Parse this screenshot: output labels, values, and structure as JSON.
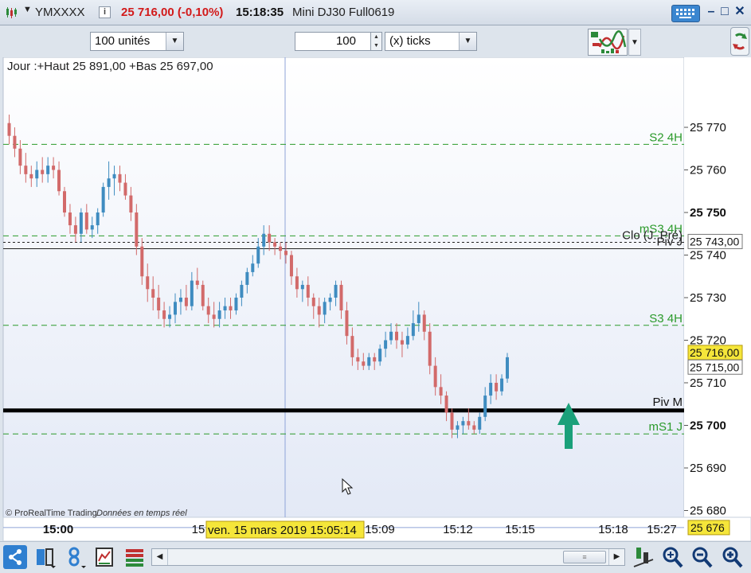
{
  "titlebar": {
    "symbol": "YMXXXX",
    "price": "25 716,00 (-0,10%)",
    "clock": "15:18:35",
    "instrument": "Mini DJ30 Full0619"
  },
  "toolbar": {
    "units_combo": "100 unités",
    "quantity_value": "100",
    "ticks_combo": "(x) ticks"
  },
  "chart": {
    "header": "Jour :+Haut 25 891,00 +Bas 25 697,00",
    "copyright": "© ProRealTime Trading",
    "realtime": "Données en temps réel",
    "crosshair_date": "ven. 15 mars 2019 15:05:14",
    "price_labels": {
      "last": "25 716,00",
      "bid": "25 715,00",
      "close_prev": "25 743,00",
      "cursor": "25 676"
    },
    "line_labels": {
      "s2": "S2 4H",
      "ms3": "mS3 4H",
      "clo": "Clo (J. Pré)",
      "piv": "Piv J",
      "s3": "S3 4H",
      "pivm": "Piv M",
      "ms1": "mS1 J"
    },
    "colors": {
      "up": "#3f8cc0",
      "down": "#d26a6a",
      "level_green": "#2a9a2a",
      "arrow": "#1aa07a",
      "highlight": "#f5e63a"
    }
  },
  "chart_data": {
    "type": "candlestick",
    "yticks": [
      25680,
      25690,
      25700,
      25710,
      25720,
      25730,
      25740,
      25750,
      25760,
      25770
    ],
    "ytick_labels": [
      "25 680",
      "25 690",
      "25 700",
      "25 710",
      "25 720",
      "25 730",
      "25 740",
      "25 750",
      "25 760",
      "25 770"
    ],
    "bold_ticks": [
      25750,
      25700
    ],
    "xtick_labels": [
      "15:00",
      "15",
      "15:09",
      "15:12",
      "15:15",
      "15:18",
      "15:27"
    ],
    "levels": {
      "s2_4h": 25766,
      "ms3_4h": 25744.5,
      "clo_prev": 25743,
      "piv_j": 25741.5,
      "s3_4h": 25723.5,
      "piv_m": 25703.5,
      "ms1_j": 25698,
      "cursor": 25676
    },
    "candles": [
      [
        25771,
        25773,
        25766,
        25768
      ],
      [
        25768,
        25770,
        25763,
        25765
      ],
      [
        25765,
        25767,
        25759,
        25761
      ],
      [
        25761,
        25764,
        25757,
        25759
      ],
      [
        25759,
        25761,
        25756,
        25758
      ],
      [
        25758,
        25762,
        25756,
        25760
      ],
      [
        25760,
        25763,
        25757,
        25759
      ],
      [
        25759,
        25763,
        25757,
        25761
      ],
      [
        25761,
        25763,
        25758,
        25760
      ],
      [
        25760,
        25762,
        25754,
        25755
      ],
      [
        25755,
        25756,
        25749,
        25750
      ],
      [
        25750,
        25752,
        25745,
        25747
      ],
      [
        25747,
        25749,
        25743,
        25745
      ],
      [
        25745,
        25751,
        25743,
        25750
      ],
      [
        25750,
        25752,
        25745,
        25746
      ],
      [
        25746,
        25749,
        25744,
        25747
      ],
      [
        25747,
        25751,
        25745,
        25750
      ],
      [
        25750,
        25757,
        25749,
        25756
      ],
      [
        25756,
        25762,
        25753,
        25758
      ],
      [
        25758,
        25761,
        25754,
        25759
      ],
      [
        25759,
        25761,
        25755,
        25757
      ],
      [
        25757,
        25759,
        25753,
        25754
      ],
      [
        25754,
        25756,
        25748,
        25750
      ],
      [
        25750,
        25752,
        25740,
        25742
      ],
      [
        25742,
        25744,
        25733,
        25735
      ],
      [
        25735,
        25738,
        25729,
        25732
      ],
      [
        25732,
        25735,
        25727,
        25730
      ],
      [
        25730,
        25733,
        25725,
        25727
      ],
      [
        25727,
        25729,
        25723,
        25725
      ],
      [
        25725,
        25728,
        25723,
        25726
      ],
      [
        25726,
        25731,
        25724,
        25729
      ],
      [
        25729,
        25732,
        25726,
        25730
      ],
      [
        25730,
        25733,
        25727,
        25728
      ],
      [
        25728,
        25736,
        25727,
        25734
      ],
      [
        25734,
        25737,
        25732,
        25733
      ],
      [
        25733,
        25734,
        25727,
        25728
      ],
      [
        25728,
        25730,
        25724,
        25726
      ],
      [
        25726,
        25729,
        25723,
        25725
      ],
      [
        25725,
        25729,
        25723,
        25727
      ],
      [
        25727,
        25730,
        25725,
        25728
      ],
      [
        25728,
        25730,
        25725,
        25727
      ],
      [
        25727,
        25731,
        25726,
        25730
      ],
      [
        25730,
        25734,
        25728,
        25733
      ],
      [
        25733,
        25737,
        25731,
        25736
      ],
      [
        25736,
        25740,
        25735,
        25738
      ],
      [
        25738,
        25744,
        25737,
        25742
      ],
      [
        25742,
        25747,
        25740,
        25745
      ],
      [
        25745,
        25747,
        25741,
        25743
      ],
      [
        25743,
        25744,
        25740,
        25742
      ],
      [
        25742,
        25743,
        25739,
        25741
      ],
      [
        25741,
        25743,
        25738,
        25740
      ],
      [
        25740,
        25741,
        25733,
        25735
      ],
      [
        25735,
        25737,
        25730,
        25732
      ],
      [
        25732,
        25734,
        25729,
        25733
      ],
      [
        25733,
        25735,
        25728,
        25730
      ],
      [
        25730,
        25731,
        25725,
        25728
      ],
      [
        25728,
        25730,
        25723,
        25726
      ],
      [
        25726,
        25730,
        25724,
        25729
      ],
      [
        25729,
        25731,
        25727,
        25730
      ],
      [
        25730,
        25734,
        25728,
        25733
      ],
      [
        25733,
        25734,
        25725,
        25727
      ],
      [
        25727,
        25729,
        25719,
        25721
      ],
      [
        25721,
        25723,
        25714,
        25716
      ],
      [
        25716,
        25718,
        25713,
        25715
      ],
      [
        25715,
        25717,
        25713,
        25714
      ],
      [
        25714,
        25717,
        25713,
        25716
      ],
      [
        25716,
        25717,
        25713,
        25715
      ],
      [
        25715,
        25719,
        25714,
        25718
      ],
      [
        25718,
        25722,
        25716,
        25720
      ],
      [
        25720,
        25724,
        25719,
        25722
      ],
      [
        25722,
        25724,
        25718,
        25720
      ],
      [
        25720,
        25722,
        25716,
        25719
      ],
      [
        25719,
        25723,
        25718,
        25721
      ],
      [
        25721,
        25727,
        25720,
        25724
      ],
      [
        25724,
        25729,
        25722,
        25726
      ],
      [
        25726,
        25727,
        25720,
        25722
      ],
      [
        25722,
        25724,
        25712,
        25714
      ],
      [
        25714,
        25716,
        25707,
        25709
      ],
      [
        25709,
        25712,
        25705,
        25707
      ],
      [
        25707,
        25708,
        25701,
        25703
      ],
      [
        25703,
        25704,
        25697,
        25699
      ],
      [
        25699,
        25701,
        25697,
        25700
      ],
      [
        25700,
        25702,
        25698,
        25701
      ],
      [
        25701,
        25704,
        25699,
        25700
      ],
      [
        25700,
        25701,
        25698,
        25699
      ],
      [
        25699,
        25703,
        25698,
        25702
      ],
      [
        25702,
        25709,
        25701,
        25707
      ],
      [
        25707,
        25712,
        25705,
        25710
      ],
      [
        25710,
        25712,
        25706,
        25708
      ],
      [
        25708,
        25712,
        25707,
        25711
      ],
      [
        25711,
        25717,
        25710,
        25716
      ]
    ]
  },
  "bottombar": {
    "scroll_thumb_grip": "≡"
  }
}
